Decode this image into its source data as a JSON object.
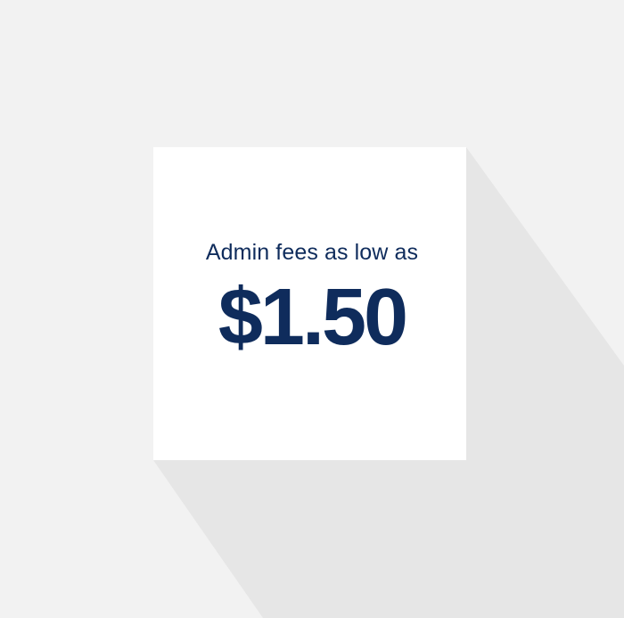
{
  "promo": {
    "headline": "Admin fees as low as",
    "price": "$1.50"
  },
  "colors": {
    "background": "#f2f2f2",
    "shadow": "#e6e6e6",
    "card": "#ffffff",
    "text": "#0f2c5c"
  }
}
